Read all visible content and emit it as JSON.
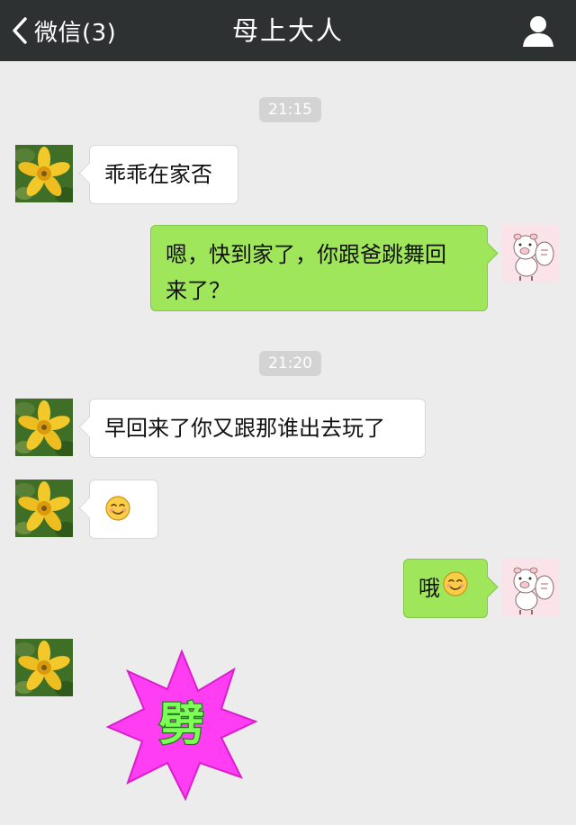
{
  "header": {
    "back_label": "微信(3)",
    "title": "母上大人",
    "back_icon": "chevron-left-icon",
    "profile_icon": "person-icon"
  },
  "messages": [
    {
      "type": "time",
      "text": "21:15"
    },
    {
      "type": "text",
      "from": "contact",
      "text": "乖乖在家否"
    },
    {
      "type": "text",
      "from": "me",
      "line1": "嗯，快到家了，你跟爸跳舞回",
      "line2": "来了？"
    },
    {
      "type": "time",
      "text": "21:20"
    },
    {
      "type": "text",
      "from": "contact",
      "text": "早回来了你又跟那谁出去玩了"
    },
    {
      "type": "emoji",
      "from": "contact",
      "emoji": "smiling-face-icon"
    },
    {
      "type": "text",
      "from": "me",
      "text": "哦",
      "emoji": "smiling-face-icon"
    },
    {
      "type": "sticker",
      "from": "contact",
      "text": "劈"
    }
  ],
  "colors": {
    "nav_background": "#2e3132",
    "chat_background": "#ececec",
    "my_bubble": "#9fe65b",
    "contact_bubble": "#ffffff",
    "sticker_star": "#ff3df2",
    "sticker_text": "#7dff57"
  }
}
